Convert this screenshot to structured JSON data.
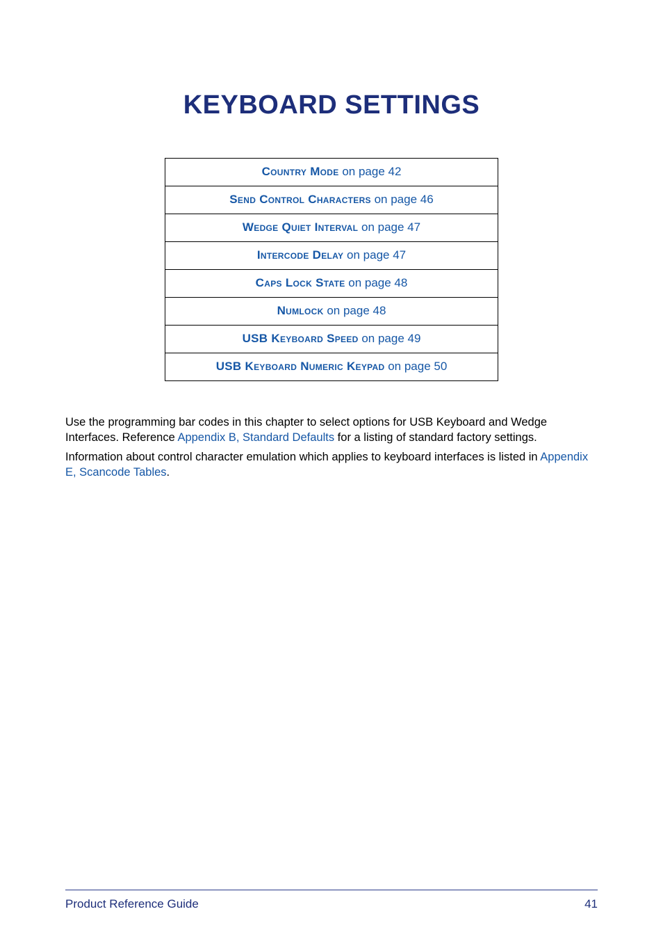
{
  "title": "KEYBOARD SETTINGS",
  "toc": [
    {
      "label_sc": "Country Mode",
      "rest": " on page 42"
    },
    {
      "label_sc": "Send Control Characters",
      "rest": " on page 46"
    },
    {
      "label_sc": "Wedge Quiet Interval",
      "rest": " on page 47"
    },
    {
      "label_sc": "Intercode Delay",
      "rest": " on page 47"
    },
    {
      "label_sc": "Caps Lock State",
      "rest": " on page 48"
    },
    {
      "label_sc": "Numlock",
      "rest": " on page 48"
    },
    {
      "label_sc": "USB Keyboard Speed",
      "rest": " on page 49"
    },
    {
      "label_sc": "USB Keyboard Numeric Keypad",
      "rest": " on page 50"
    }
  ],
  "body": {
    "p1_a": "Use the programming bar codes in this chapter to select options for USB Keyboard and Wedge Interfaces. Reference ",
    "p1_link": "Appendix B, Standard Defaults",
    "p1_b": " for a listing of standard factory settings.",
    "p2_a": "Information about control character emulation which applies to keyboard interfaces is listed in ",
    "p2_link": "Appendix E, Scancode Tables",
    "p2_b": "."
  },
  "footer": {
    "left": "Product Reference Guide",
    "right": "41"
  }
}
